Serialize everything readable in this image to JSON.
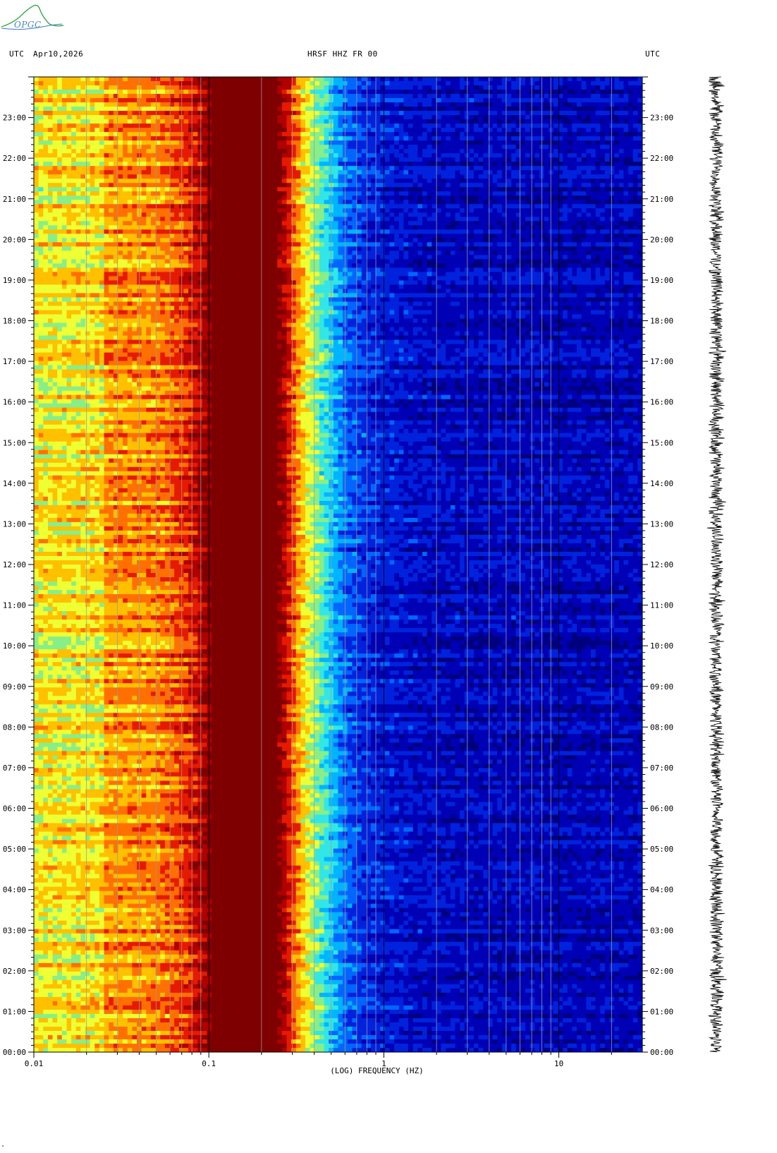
{
  "header": {
    "left_tz": "UTC",
    "date": "Apr10,2026",
    "station": "HRSF HHZ FR 00",
    "right_tz": "UTC"
  },
  "logo": {
    "text": "OPGC"
  },
  "corner_mark": "\"",
  "colors": {
    "palette": [
      "#00007f",
      "#0000b4",
      "#0022dd",
      "#0066ff",
      "#00b4ff",
      "#33e6e6",
      "#88ee88",
      "#eeff33",
      "#ffc000",
      "#ff7000",
      "#e61a00",
      "#b00000",
      "#7f0000"
    ],
    "axis": "#000000",
    "grid": "#9a9a9a"
  },
  "chart_data": {
    "type": "heatmap",
    "xlabel": "(LOG) FREQUENCY (HZ)",
    "x_scale": "log",
    "xlim": [
      0.01,
      30
    ],
    "x_ticks": [
      {
        "value": 0.01,
        "label": "0.01"
      },
      {
        "value": 0.1,
        "label": "0.1"
      },
      {
        "value": 1,
        "label": "1"
      },
      {
        "value": 10,
        "label": "10"
      }
    ],
    "ylim_hours": [
      0,
      24
    ],
    "y_ticks": [
      {
        "value": 0,
        "label": "00:00"
      },
      {
        "value": 1,
        "label": "01:00"
      },
      {
        "value": 2,
        "label": "02:00"
      },
      {
        "value": 3,
        "label": "03:00"
      },
      {
        "value": 4,
        "label": "04:00"
      },
      {
        "value": 5,
        "label": "05:00"
      },
      {
        "value": 6,
        "label": "06:00"
      },
      {
        "value": 7,
        "label": "07:00"
      },
      {
        "value": 8,
        "label": "08:00"
      },
      {
        "value": 9,
        "label": "09:00"
      },
      {
        "value": 10,
        "label": "10:00"
      },
      {
        "value": 11,
        "label": "11:00"
      },
      {
        "value": 12,
        "label": "12:00"
      },
      {
        "value": 13,
        "label": "13:00"
      },
      {
        "value": 14,
        "label": "14:00"
      },
      {
        "value": 15,
        "label": "15:00"
      },
      {
        "value": 16,
        "label": "16:00"
      },
      {
        "value": 17,
        "label": "17:00"
      },
      {
        "value": 18,
        "label": "18:00"
      },
      {
        "value": 19,
        "label": "19:00"
      },
      {
        "value": 20,
        "label": "20:00"
      },
      {
        "value": 21,
        "label": "21:00"
      },
      {
        "value": 22,
        "label": "22:00"
      },
      {
        "value": 23,
        "label": "23:00"
      }
    ],
    "grid_freqs": [
      0.02,
      0.03,
      0.04,
      0.05,
      0.06,
      0.07,
      0.08,
      0.09,
      0.2,
      0.3,
      0.4,
      0.5,
      0.6,
      0.7,
      0.8,
      0.9,
      2,
      3,
      4,
      5,
      6,
      7,
      8,
      9,
      20
    ],
    "spectrum_profile": [
      {
        "f": 0.01,
        "level": 7.2
      },
      {
        "f": 0.0245,
        "level": 7.4
      },
      {
        "f": 0.025,
        "level": 8.4
      },
      {
        "f": 0.05,
        "level": 8.6
      },
      {
        "f": 0.072,
        "level": 9.6
      },
      {
        "f": 0.1,
        "level": 11.6
      },
      {
        "f": 0.101,
        "level": 12
      },
      {
        "f": 0.2,
        "level": 12
      },
      {
        "f": 0.26,
        "level": 11.6
      },
      {
        "f": 0.3,
        "level": 9.5
      },
      {
        "f": 0.35,
        "level": 7.5
      },
      {
        "f": 0.42,
        "level": 5.8
      },
      {
        "f": 0.5,
        "level": 4.4
      },
      {
        "f": 0.6,
        "level": 3
      },
      {
        "f": 0.8,
        "level": 2
      },
      {
        "f": 1.5,
        "level": 1.3
      },
      {
        "f": 3,
        "level": 1.1
      },
      {
        "f": 30,
        "level": 1
      }
    ]
  }
}
